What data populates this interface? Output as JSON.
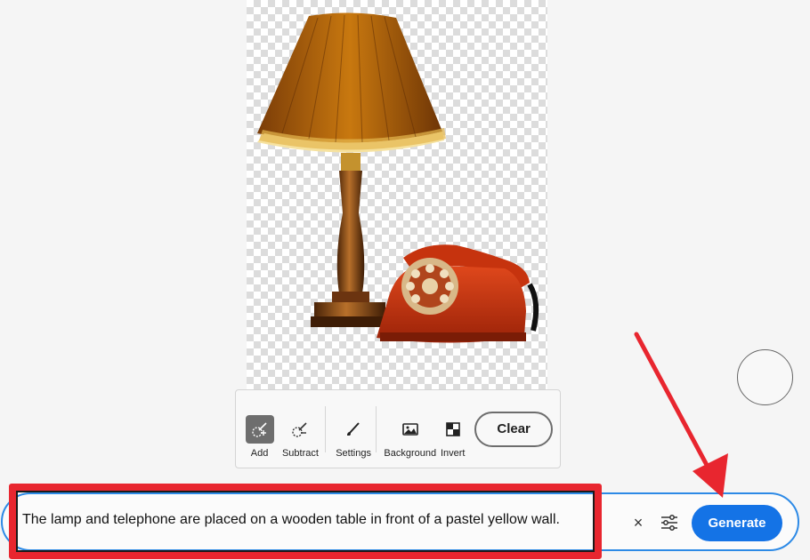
{
  "canvas": {
    "content": "lamp-and-telephone-image"
  },
  "toolbar": {
    "tools": [
      {
        "label": "Add",
        "icon": "brush-add-icon",
        "active": true
      },
      {
        "label": "Subtract",
        "icon": "brush-subtract-icon",
        "active": false
      },
      {
        "label": "Settings",
        "icon": "brush-settings-icon",
        "active": false
      },
      {
        "label": "Background",
        "icon": "image-background-icon",
        "active": false
      },
      {
        "label": "Invert",
        "icon": "invert-icon",
        "active": false
      }
    ],
    "clear_label": "Clear"
  },
  "prompt": {
    "text": "The lamp and telephone are placed on a wooden table in front of a pastel yellow wall.",
    "clear_icon": "×",
    "settings_icon": "sliders-icon",
    "generate_label": "Generate"
  },
  "colors": {
    "accent": "#1473e6",
    "highlight_annotation": "#e8262f",
    "arrow_annotation": "#e8262f"
  }
}
